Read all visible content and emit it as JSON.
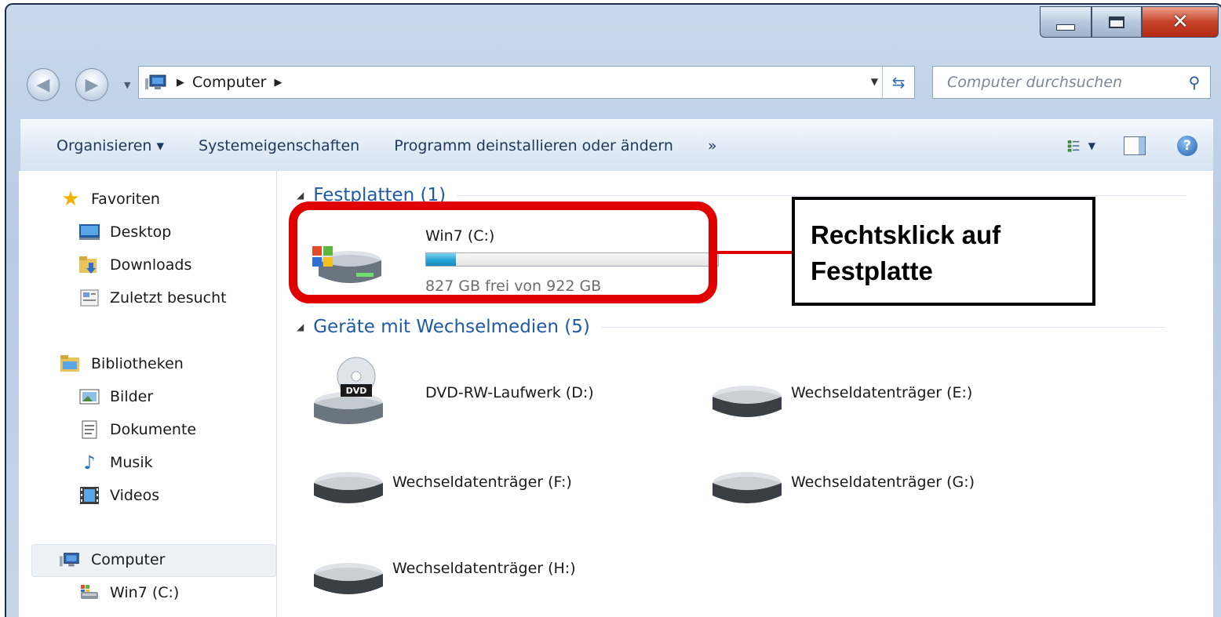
{
  "window": {
    "controls": {
      "minimize": "minimize",
      "maximize": "maximize",
      "close": "✕"
    }
  },
  "address_bar": {
    "crumbs": [
      "Computer"
    ],
    "search_placeholder": "Computer durchsuchen"
  },
  "toolbar": {
    "items": [
      "Organisieren ▾",
      "Systemeigenschaften",
      "Programm deinstallieren oder ändern",
      "»"
    ]
  },
  "nav_pane": {
    "favorites": {
      "label": "Favoriten",
      "items": [
        "Desktop",
        "Downloads",
        "Zuletzt besucht"
      ]
    },
    "libraries": {
      "label": "Bibliotheken",
      "items": [
        "Bilder",
        "Dokumente",
        "Musik",
        "Videos"
      ]
    },
    "computer": {
      "label": "Computer",
      "items": [
        "Win7 (C:)"
      ]
    }
  },
  "groups": {
    "hard_drives": {
      "title": "Festplatten (1)",
      "drives": [
        {
          "name": "Win7 (C:)",
          "free_text": "827 GB frei von 922 GB",
          "used_fraction": 0.103
        }
      ]
    },
    "removable": {
      "title": "Geräte mit Wechselmedien (5)",
      "drives": [
        {
          "name": "DVD-RW-Laufwerk (D:)",
          "icon": "dvd-drive-icon"
        },
        {
          "name": "Wechseldatenträger (E:)",
          "icon": "removable-drive-icon"
        },
        {
          "name": "Wechseldatenträger (F:)",
          "icon": "removable-drive-icon"
        },
        {
          "name": "Wechseldatenträger (G:)",
          "icon": "removable-drive-icon"
        },
        {
          "name": "Wechseldatenträger (H:)",
          "icon": "removable-drive-icon"
        }
      ]
    }
  },
  "annotation": {
    "text": "Rechtsklick auf\nFestplatte",
    "color": "#e10000"
  }
}
